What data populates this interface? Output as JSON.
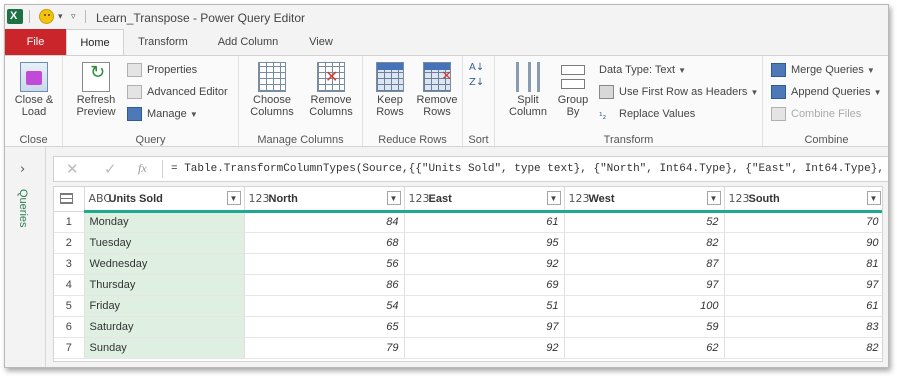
{
  "window": {
    "title": "Learn_Transpose - Power Query Editor"
  },
  "quick_access": {
    "app_icon": "excel-icon",
    "qat_icon": "smiley-icon"
  },
  "tabs": [
    {
      "label": "File"
    },
    {
      "label": "Home"
    },
    {
      "label": "Transform"
    },
    {
      "label": "Add Column"
    },
    {
      "label": "View"
    }
  ],
  "ribbon": {
    "close": {
      "button": "Close &\nLoad",
      "group": "Close"
    },
    "query": {
      "refresh": "Refresh\nPreview",
      "properties": "Properties",
      "advanced_editor": "Advanced Editor",
      "manage": "Manage",
      "group": "Query"
    },
    "manage_columns": {
      "choose": "Choose\nColumns",
      "remove": "Remove\nColumns",
      "group": "Manage Columns"
    },
    "reduce_rows": {
      "keep": "Keep\nRows",
      "remove": "Remove\nRows",
      "group": "Reduce Rows"
    },
    "sort": {
      "group": "Sort"
    },
    "transform": {
      "split": "Split\nColumn",
      "group_by": "Group\nBy",
      "data_type": "Data Type: Text",
      "first_row_headers": "Use First Row as Headers",
      "replace_values": "Replace Values",
      "group": "Transform"
    },
    "combine": {
      "merge": "Merge Queries",
      "append": "Append Queries",
      "combine_files": "Combine Files",
      "group": "Combine"
    }
  },
  "side_panel": {
    "label": "Queries"
  },
  "formula_bar": {
    "fx": "fx",
    "formula": "= Table.TransformColumnTypes(Source,{{\"Units Sold\", type text}, {\"North\", Int64.Type}, {\"East\", Int64.Type},"
  },
  "table": {
    "columns": [
      {
        "type": "ABC",
        "name": "Units Sold"
      },
      {
        "type": "123",
        "name": "North"
      },
      {
        "type": "123",
        "name": "East"
      },
      {
        "type": "123",
        "name": "West"
      },
      {
        "type": "123",
        "name": "South"
      }
    ],
    "rows": [
      [
        "1",
        "Monday",
        "84",
        "61",
        "52",
        "70"
      ],
      [
        "2",
        "Tuesday",
        "68",
        "95",
        "82",
        "90"
      ],
      [
        "3",
        "Wednesday",
        "56",
        "92",
        "87",
        "81"
      ],
      [
        "4",
        "Thursday",
        "86",
        "69",
        "97",
        "97"
      ],
      [
        "5",
        "Friday",
        "54",
        "51",
        "100",
        "61"
      ],
      [
        "6",
        "Saturday",
        "65",
        "97",
        "59",
        "83"
      ],
      [
        "7",
        "Sunday",
        "79",
        "92",
        "62",
        "82"
      ]
    ]
  },
  "colors": {
    "file_tab": "#c9252b",
    "header_rule": "#1daa8e",
    "day_column": "#dff0e2"
  }
}
